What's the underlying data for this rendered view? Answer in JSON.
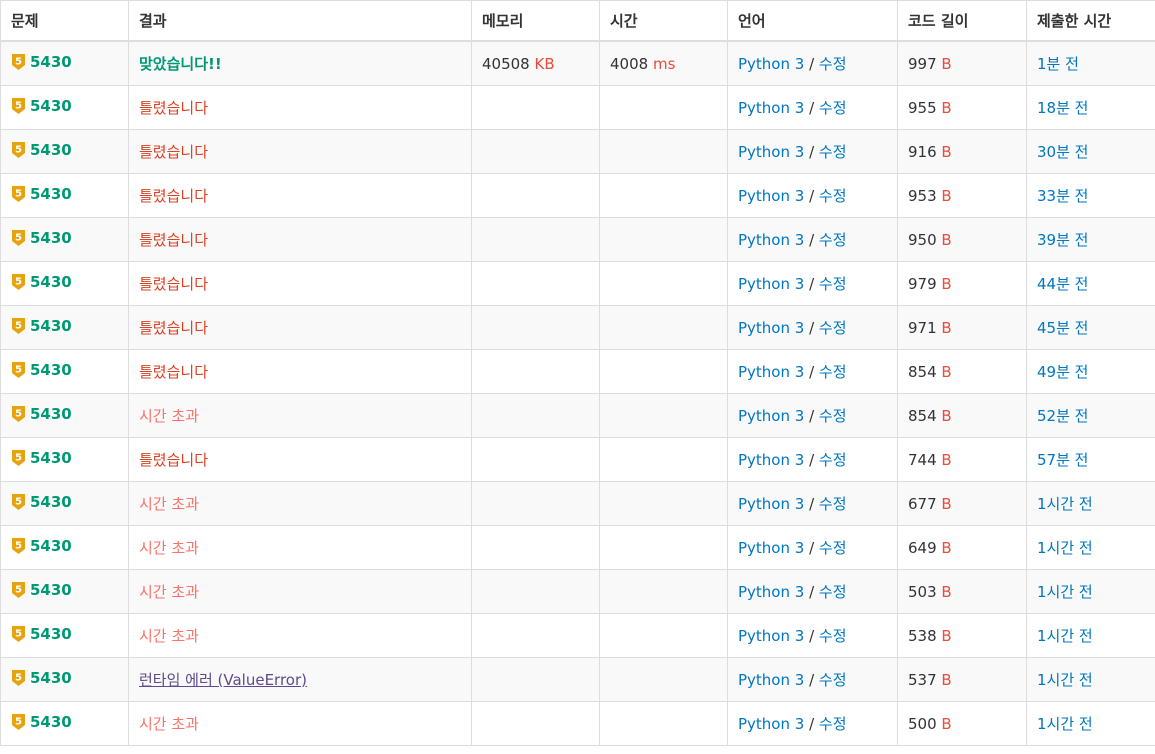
{
  "headers": [
    "문제",
    "결과",
    "메모리",
    "시간",
    "언어",
    "코드 길이",
    "제출한 시간"
  ],
  "units": {
    "memory": "KB",
    "time": "ms",
    "code": "B"
  },
  "edit_label": "수정",
  "tier_icon": "bronze-5-tier-icon",
  "tier_number": "5",
  "colors": {
    "accepted": "#009874",
    "wrong": "#dd4124",
    "timeout": "#fa7268",
    "runtime": "#5f4b8b",
    "link": "#0076c0",
    "unit": "#e74c3c",
    "tier": "#e8a20c"
  },
  "rows": [
    {
      "problem": "5430",
      "result": "맞았습니다!!",
      "rtype": "ac",
      "memory": "40508",
      "time": "4008",
      "lang": "Python 3",
      "code": "997",
      "ago": "1분 전"
    },
    {
      "problem": "5430",
      "result": "틀렸습니다",
      "rtype": "wa",
      "memory": "",
      "time": "",
      "lang": "Python 3",
      "code": "955",
      "ago": "18분 전"
    },
    {
      "problem": "5430",
      "result": "틀렸습니다",
      "rtype": "wa",
      "memory": "",
      "time": "",
      "lang": "Python 3",
      "code": "916",
      "ago": "30분 전"
    },
    {
      "problem": "5430",
      "result": "틀렸습니다",
      "rtype": "wa",
      "memory": "",
      "time": "",
      "lang": "Python 3",
      "code": "953",
      "ago": "33분 전"
    },
    {
      "problem": "5430",
      "result": "틀렸습니다",
      "rtype": "wa",
      "memory": "",
      "time": "",
      "lang": "Python 3",
      "code": "950",
      "ago": "39분 전"
    },
    {
      "problem": "5430",
      "result": "틀렸습니다",
      "rtype": "wa",
      "memory": "",
      "time": "",
      "lang": "Python 3",
      "code": "979",
      "ago": "44분 전"
    },
    {
      "problem": "5430",
      "result": "틀렸습니다",
      "rtype": "wa",
      "memory": "",
      "time": "",
      "lang": "Python 3",
      "code": "971",
      "ago": "45분 전"
    },
    {
      "problem": "5430",
      "result": "틀렸습니다",
      "rtype": "wa",
      "memory": "",
      "time": "",
      "lang": "Python 3",
      "code": "854",
      "ago": "49분 전"
    },
    {
      "problem": "5430",
      "result": "시간 초과",
      "rtype": "tle",
      "memory": "",
      "time": "",
      "lang": "Python 3",
      "code": "854",
      "ago": "52분 전"
    },
    {
      "problem": "5430",
      "result": "틀렸습니다",
      "rtype": "wa",
      "memory": "",
      "time": "",
      "lang": "Python 3",
      "code": "744",
      "ago": "57분 전"
    },
    {
      "problem": "5430",
      "result": "시간 초과",
      "rtype": "tle",
      "memory": "",
      "time": "",
      "lang": "Python 3",
      "code": "677",
      "ago": "1시간 전"
    },
    {
      "problem": "5430",
      "result": "시간 초과",
      "rtype": "tle",
      "memory": "",
      "time": "",
      "lang": "Python 3",
      "code": "649",
      "ago": "1시간 전"
    },
    {
      "problem": "5430",
      "result": "시간 초과",
      "rtype": "tle",
      "memory": "",
      "time": "",
      "lang": "Python 3",
      "code": "503",
      "ago": "1시간 전"
    },
    {
      "problem": "5430",
      "result": "시간 초과",
      "rtype": "tle",
      "memory": "",
      "time": "",
      "lang": "Python 3",
      "code": "538",
      "ago": "1시간 전"
    },
    {
      "problem": "5430",
      "result": "런타임 에러 (ValueError)",
      "rtype": "rte",
      "memory": "",
      "time": "",
      "lang": "Python 3",
      "code": "537",
      "ago": "1시간 전"
    },
    {
      "problem": "5430",
      "result": "시간 초과",
      "rtype": "tle",
      "memory": "",
      "time": "",
      "lang": "Python 3",
      "code": "500",
      "ago": "1시간 전"
    }
  ]
}
